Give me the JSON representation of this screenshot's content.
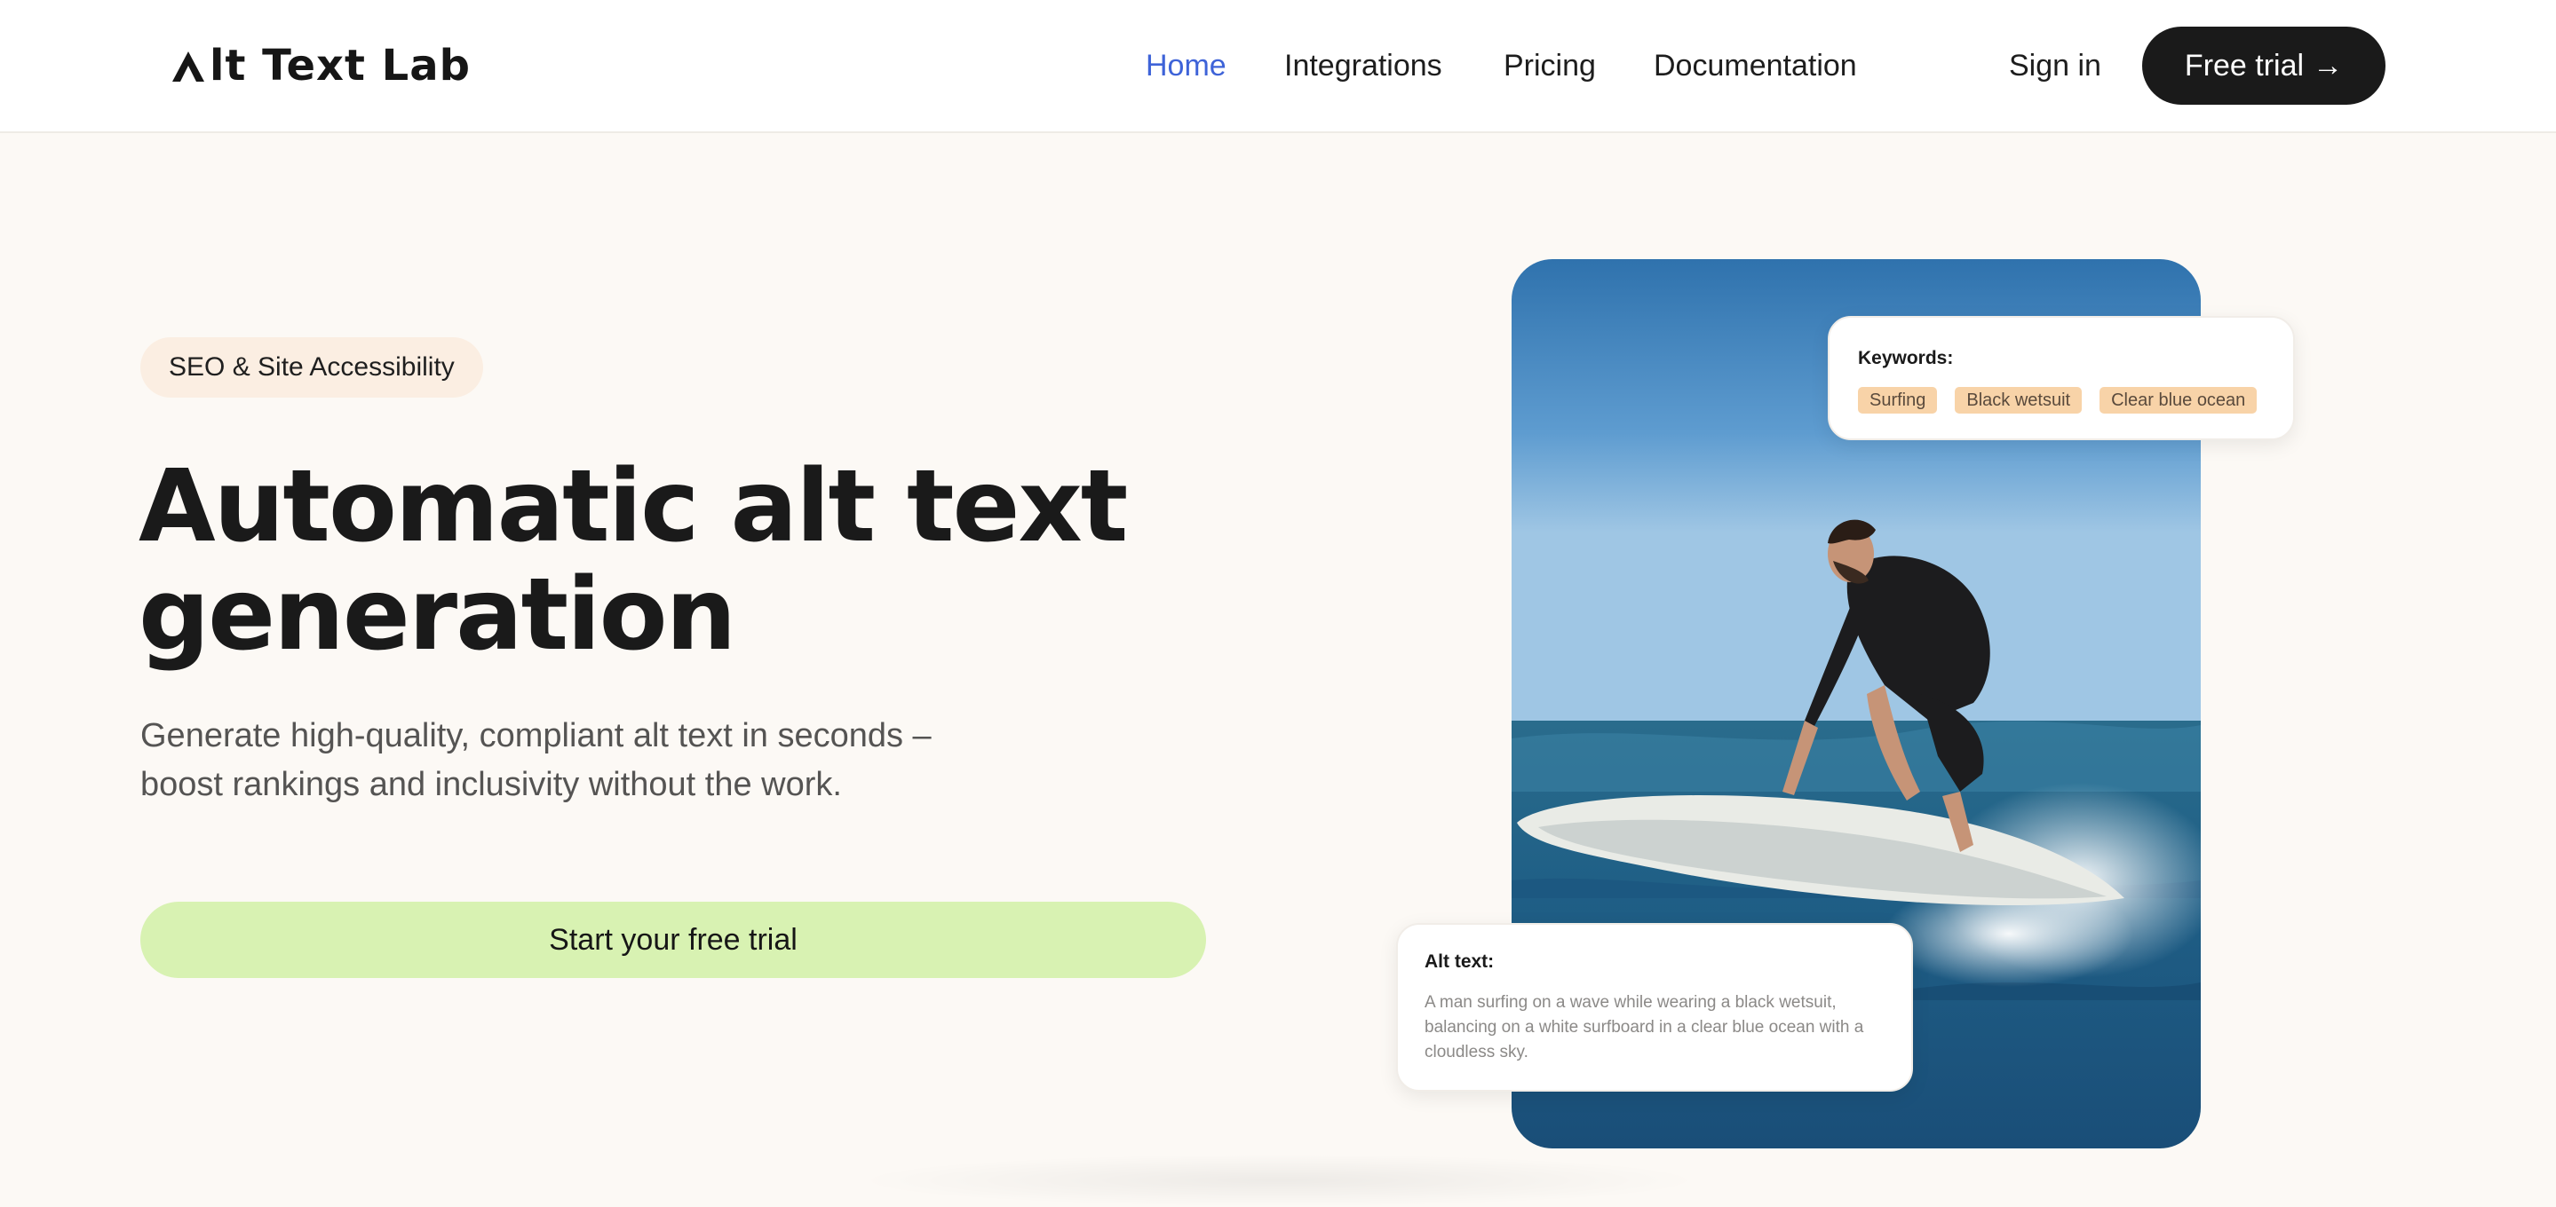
{
  "header": {
    "logo_text": "lt Text Lab",
    "logo_text_full": "Alt Text Lab",
    "nav": [
      {
        "label": "Home",
        "active": true
      },
      {
        "label": "Integrations",
        "active": false
      },
      {
        "label": "Pricing",
        "active": false
      },
      {
        "label": "Documentation",
        "active": false
      }
    ],
    "sign_in_label": "Sign in",
    "trial_label": "Free trial",
    "trial_arrow": "→"
  },
  "hero": {
    "badge": "SEO & Site Accessibility",
    "title_line1": "Automatic alt text",
    "title_line2": "generation",
    "subtitle_line1": "Generate high-quality, compliant alt text in seconds –",
    "subtitle_line2": "boost rankings and inclusivity without the work.",
    "cta_label": "Start your free trial"
  },
  "example": {
    "keywords_title": "Keywords:",
    "keywords": [
      "Surfing",
      "Black wetsuit",
      "Clear blue ocean"
    ],
    "alt_title": "Alt text:",
    "alt_text": "A man surfing on a wave while wearing a black wetsuit, balancing on a white surfboard in a clear blue ocean with a cloudless sky."
  },
  "colors": {
    "page_bg": "#fcf9f5",
    "accent_nav": "#3e63d8",
    "cta_bg": "#d8f2b2",
    "badge_bg": "#fbeee2",
    "chip_bg": "#f8d3a8",
    "dark_button": "#1a1a1a"
  }
}
